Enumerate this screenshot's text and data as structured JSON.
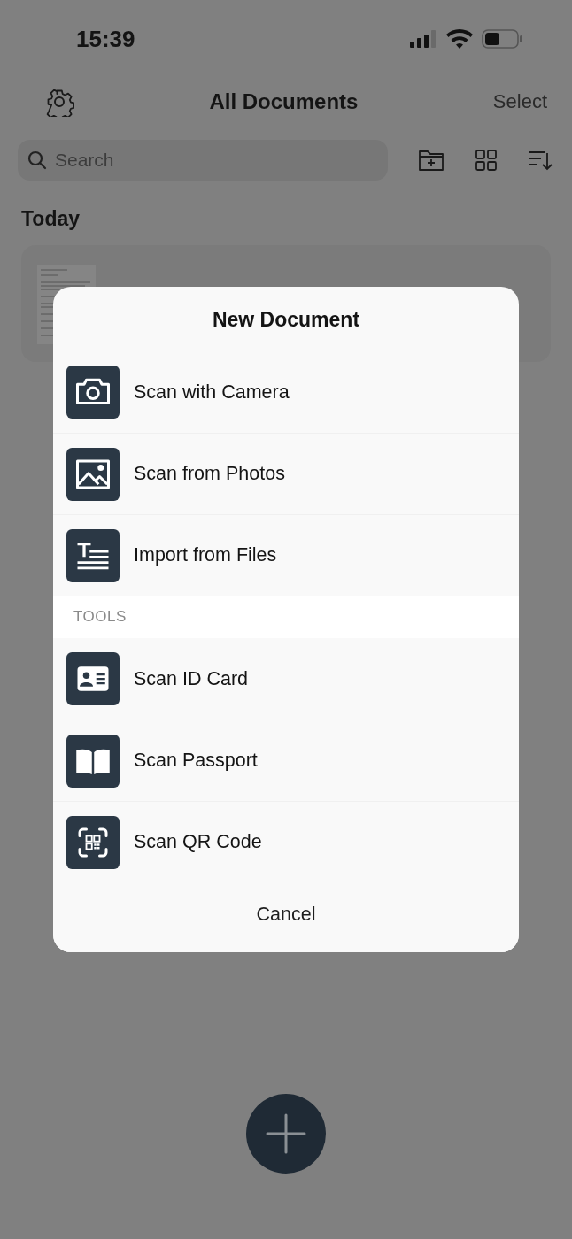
{
  "status_bar": {
    "time": "15:39"
  },
  "nav": {
    "title": "All Documents",
    "action": "Select"
  },
  "search": {
    "placeholder": "Search"
  },
  "section": "Today",
  "documents": [
    {
      "kind": "document"
    }
  ],
  "sheet": {
    "title": "New Document",
    "groups": [
      {
        "items": [
          {
            "label": "Scan with Camera",
            "kind": "camera"
          },
          {
            "label": "Scan from Photos",
            "kind": "photo"
          },
          {
            "label": "Import from Files",
            "kind": "files"
          }
        ]
      },
      {
        "header": "TOOLS",
        "items": [
          {
            "label": "Scan ID Card",
            "kind": "idcard"
          },
          {
            "label": "Scan Passport",
            "kind": "passport"
          },
          {
            "label": "Scan QR Code",
            "kind": "qr"
          }
        ]
      }
    ],
    "cancel": "Cancel"
  }
}
